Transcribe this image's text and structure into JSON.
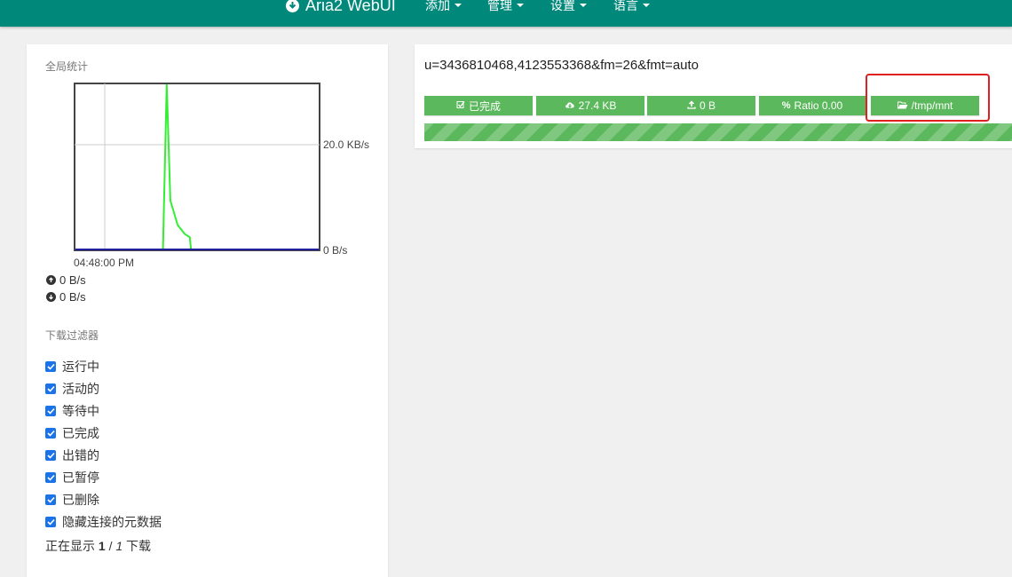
{
  "navbar": {
    "brand": "Aria2 WebUI",
    "menus": [
      "添加",
      "管理",
      "设置",
      "语言"
    ]
  },
  "sidebar": {
    "global_stats_title": "全局统计",
    "chart_data": {
      "type": "line",
      "time_label": "04:48:00 PM",
      "y_tick_labels": [
        "20.0 KB/s",
        "0 B/s"
      ],
      "ylim": [
        0,
        27
      ],
      "grid": true,
      "series": [
        {
          "color": "#33ee33",
          "points": [
            [
              0,
              0
            ],
            [
              0.36,
              0
            ],
            [
              0.375,
              27
            ],
            [
              0.39,
              8
            ],
            [
              0.42,
              4
            ],
            [
              0.45,
              2.5
            ],
            [
              0.47,
              2
            ],
            [
              0.475,
              0
            ],
            [
              1,
              0
            ]
          ]
        },
        {
          "color": "#2020a0",
          "points": [
            [
              0,
              0
            ],
            [
              1,
              0
            ]
          ]
        }
      ]
    },
    "upload_speed": "0 B/s",
    "download_speed": "0 B/s",
    "filter_title": "下载过滤器",
    "filters": [
      {
        "label": "运行中",
        "checked": true
      },
      {
        "label": "活动的",
        "checked": true
      },
      {
        "label": "等待中",
        "checked": true
      },
      {
        "label": "已完成",
        "checked": true
      },
      {
        "label": "出错的",
        "checked": true
      },
      {
        "label": "已暂停",
        "checked": true
      },
      {
        "label": "已删除",
        "checked": true
      },
      {
        "label": "隐藏连接的元数据",
        "checked": true
      }
    ],
    "showing": {
      "prefix": "正在显示",
      "current": "1",
      "sep": "/",
      "total": "1",
      "suffix": "下载"
    }
  },
  "download": {
    "name": "u=3436810468,4123553368&fm=26&fmt=auto",
    "status": "已完成",
    "downloaded": "27.4 KB",
    "uploaded": "0 B",
    "ratio": "Ratio 0.00",
    "path": "/tmp/mnt",
    "progress": 1.0,
    "accent_color": "#5cb85c"
  },
  "colors": {
    "navbar": "#00897b",
    "highlight": "#e02020"
  }
}
